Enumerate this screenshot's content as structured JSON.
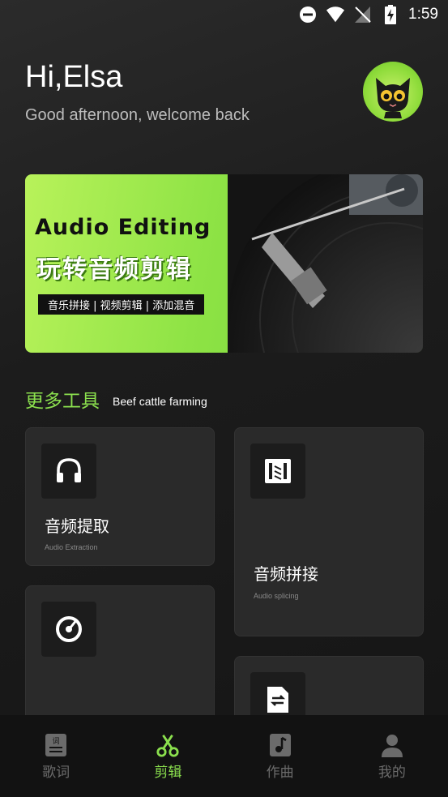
{
  "status_bar": {
    "time": "1:59"
  },
  "greeting": {
    "title": "Hi,Elsa",
    "subtitle": "Good afternoon, welcome back"
  },
  "banner": {
    "title": "Audio Editing",
    "title_cn": "玩转音频剪辑",
    "tagline": "音乐拼接 | 视频剪辑 | 添加混音"
  },
  "section": {
    "title": "更多工具",
    "subtitle": "Beef cattle farming"
  },
  "tools": [
    {
      "title": "音频提取",
      "subtitle": "Audio Extraction",
      "icon": "headphones-icon"
    },
    {
      "title": "音频拼接",
      "subtitle": "Audio splicing",
      "icon": "film-strip-icon"
    },
    {
      "title": "",
      "subtitle": "",
      "icon": "disc-icon"
    },
    {
      "title": "",
      "subtitle": "",
      "icon": "file-convert-icon"
    }
  ],
  "bottom_nav": [
    {
      "label": "歌词",
      "icon": "lyrics-icon",
      "active": false
    },
    {
      "label": "剪辑",
      "icon": "scissors-icon",
      "active": true
    },
    {
      "label": "作曲",
      "icon": "music-note-icon",
      "active": false
    },
    {
      "label": "我的",
      "icon": "person-icon",
      "active": false
    }
  ],
  "colors": {
    "accent": "#8be04e",
    "background": "#1c1c1c",
    "card": "#2a2a2a"
  }
}
